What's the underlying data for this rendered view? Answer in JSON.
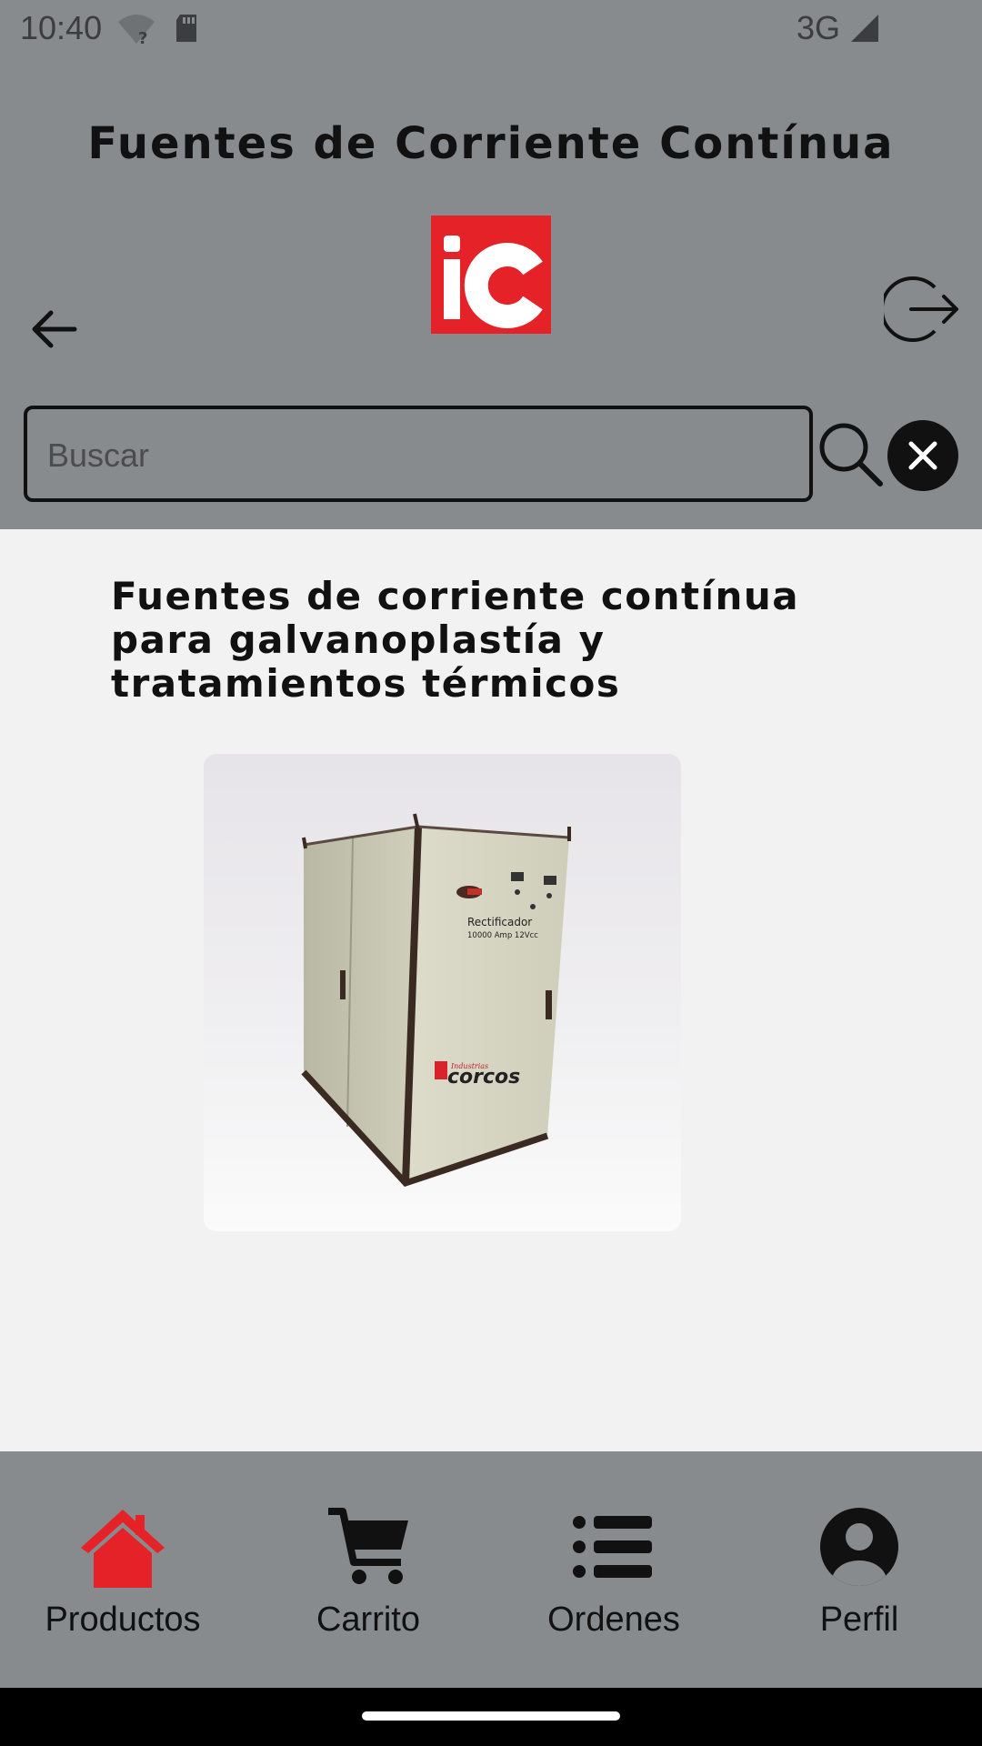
{
  "status_bar": {
    "time": "10:40",
    "network": "3G",
    "icons": [
      "wifi-unknown-icon",
      "sd-card-icon",
      "signal-icon"
    ]
  },
  "header": {
    "title": "Fuentes de Corriente Contínua",
    "logo_text": "iC",
    "back_icon": "arrow-left-icon",
    "logout_icon": "logout-icon"
  },
  "search": {
    "placeholder": "Buscar",
    "value": "",
    "search_icon": "search-icon",
    "clear_icon": "close-circle-icon"
  },
  "product": {
    "title": "Fuentes de corriente contínua para galvanoplastía y tratamientos térmicos",
    "image_label_line1": "Rectificador",
    "image_label_line2": "10000 Amp 12Vcc",
    "image_brand": "corcos",
    "image_brand_small": "Industrias"
  },
  "bottom_nav": {
    "items": [
      {
        "label": "Productos",
        "icon": "home-icon",
        "active": true,
        "color": "#e52228"
      },
      {
        "label": "Carrito",
        "icon": "cart-icon",
        "active": false
      },
      {
        "label": "Ordenes",
        "icon": "list-icon",
        "active": false
      },
      {
        "label": "Perfil",
        "icon": "profile-icon",
        "active": false
      }
    ]
  },
  "colors": {
    "header_bg": "#878b8e",
    "content_bg": "#f2f2f2",
    "accent": "#e52228"
  }
}
